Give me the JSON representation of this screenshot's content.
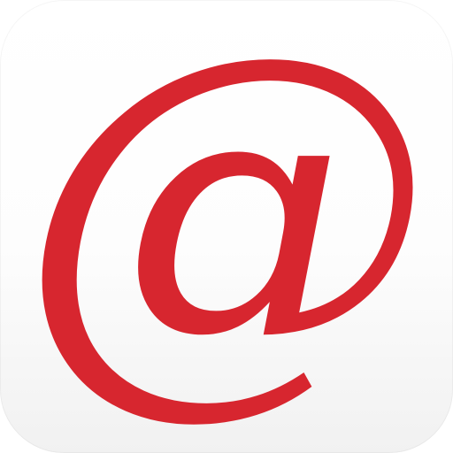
{
  "icon": {
    "glyph": "@",
    "glyph_color": "#d7262f",
    "background_top_color": "#ffffff",
    "background_bottom_color": "#f1f1f1"
  }
}
